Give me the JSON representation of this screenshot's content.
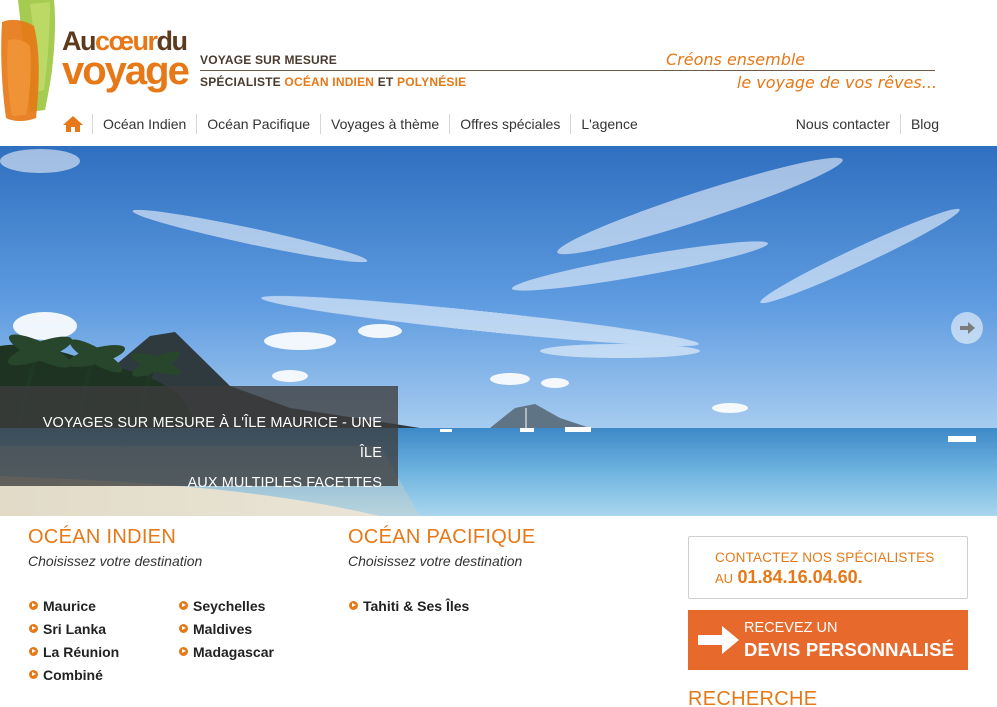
{
  "logo": {
    "line1_a": "Au",
    "line1_b": "cœur",
    "line1_c": "du",
    "line2": "voyage"
  },
  "tagline": {
    "line1": "VOYAGE SUR MESURE",
    "line2_a": "SPÉCIALISTE ",
    "line2_b": "OCÉAN INDIEN",
    "line2_c": " ET ",
    "line2_d": "POLYNÉSIE"
  },
  "slogan": {
    "line1": "Créons ensemble",
    "line2": "le voyage de vos rêves..."
  },
  "nav": {
    "home_icon": "home-icon",
    "items": [
      "Océan Indien",
      "Océan Pacifique",
      "Voyages à thème",
      "Offres spéciales",
      "L'agence"
    ],
    "right_items": [
      "Nous contacter",
      "Blog"
    ]
  },
  "hero": {
    "caption_line1": "VOYAGES SUR MESURE À L'ÎLE MAURICE - UNE ÎLE",
    "caption_line2": "AUX MULTIPLES FACETTES",
    "next_icon": "arrow-right-circle-icon"
  },
  "ocean_indien": {
    "title": "OCÉAN INDIEN",
    "subtitle": "Choisissez votre destination",
    "col1": [
      "Maurice",
      "Sri Lanka",
      "La Réunion",
      "Combiné"
    ],
    "col2": [
      "Seychelles",
      "Maldives",
      "Madagascar"
    ]
  },
  "ocean_pacifique": {
    "title": "OCÉAN PACIFIQUE",
    "subtitle": "Choisissez votre destination",
    "col1": [
      "Tahiti & Ses Îles"
    ]
  },
  "contact": {
    "title": "CONTACTEZ NOS SPÉCIALISTES",
    "au": "AU",
    "phone": "01.84.16.04.60."
  },
  "devis": {
    "line1": "RECEVEZ UN",
    "line2": "DEVIS PERSONNALISÉ",
    "icon": "arrow-right-icon"
  },
  "recherche": {
    "title": "RECHERCHE"
  },
  "colors": {
    "accent": "#e67817",
    "devis_bg": "#e8692c",
    "brown": "#5b3a1e"
  }
}
